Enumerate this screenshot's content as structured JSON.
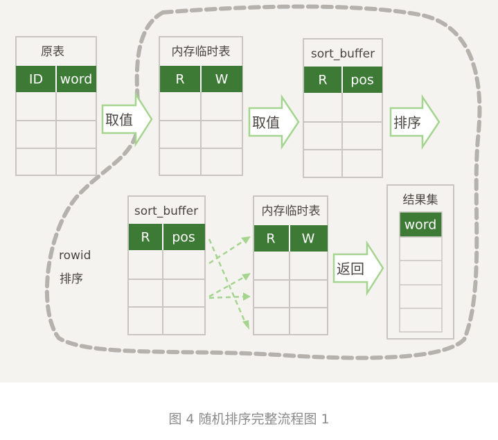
{
  "diagram": {
    "table_orig": {
      "title": "原表",
      "columns": [
        "ID",
        "word"
      ]
    },
    "table_tmp_top": {
      "title": "内存临时表",
      "columns": [
        "R",
        "W"
      ]
    },
    "sort_buffer_top": {
      "title": "sort_buffer",
      "columns": [
        "R",
        "pos"
      ]
    },
    "arrow_1": "取值",
    "arrow_2": "取值",
    "arrow_3": "排序",
    "sort_buffer_bottom": {
      "title": "sort_buffer",
      "columns": [
        "R",
        "pos"
      ]
    },
    "table_tmp_bottom": {
      "title": "内存临时表",
      "columns": [
        "R",
        "W"
      ]
    },
    "arrow_4": "返回",
    "result_set": {
      "title": "结果集",
      "columns": [
        "word"
      ]
    },
    "side_label": {
      "line1": "rowid",
      "line2": "排序"
    }
  },
  "colors": {
    "background": "#f4f3ef",
    "header_green": "#3d7a35",
    "arrow_green": "#a5d48f",
    "cell_border": "#c9c6c1",
    "dashed_outline": "#b5b2ad"
  },
  "caption": "图 4 随机排序完整流程图 1"
}
